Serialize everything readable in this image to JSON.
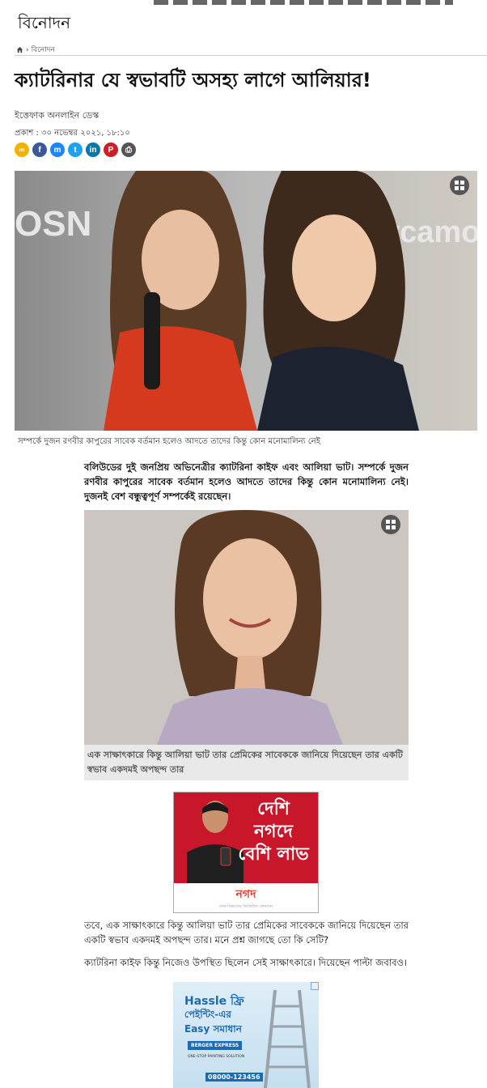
{
  "section": {
    "name": "বিনোদন"
  },
  "breadcrumb": {
    "current": "বিনোদন"
  },
  "article": {
    "headline": "ক্যাটরিনার যে স্বভাবটি অসহ্য লাগে আলিয়ার!",
    "author": "ইত্তেফাক অনলাইন ডেস্ক",
    "published": "প্রকাশ : ৩০ নভেম্বর ২০২১, ১৮:১০",
    "hero_caption": "সম্পর্কে দুজন রণবীর কাপুরের সাবেক বর্তমান হলেও আদতে তাদের কিন্তু কোন মনোমালিন্য নেই",
    "lead": "বলিউডের দুই জনপ্রিয় অভিনেত্রীর ক্যাটরিনা কাইফ এবং আলিয়া ভাট। সম্পর্কে দুজন রণবীর কাপুরের সাবেক বর্তমান হলেও আদতে তাদের কিন্তু কোন মনোমালিন্য নেই। দুজনই বেশ বন্ধুত্বপূর্ণ সম্পর্কেই রয়েছেন।",
    "photo2_caption": "এক সাক্ষাৎকারে কিন্তু আলিয়া ভাট তার প্রেমিকের সাবেককে জানিয়ে দিয়েছেন তার একটি স্বভাব একদমই অপছন্দ তার",
    "para2": "তবে, এক সাক্ষাৎকারে কিন্তু আলিয়া ভাট তার প্রেমিকের সাবেককে জানিয়ে দিয়েছেন তার একটি স্বভাব একদমই অপছন্দ তার। মনে প্রশ্ন জাগছে তো কি সেটি?",
    "para3": "ক্যাটরিনা কাইফ কিন্তু নিজেও উপস্থিত ছিলেন সেই সাক্ষাৎকারে। দিয়েছেন পাল্টা জবাবও।"
  },
  "hero_image": {
    "logo_left": "OSN",
    "logo_right": "ycamo"
  },
  "share_icons": [
    {
      "name": "link-share-icon",
      "glyph": "∞",
      "color": "#f0b400"
    },
    {
      "name": "facebook-share-icon",
      "glyph": "f",
      "color": "#3b5998"
    },
    {
      "name": "messenger-share-icon",
      "glyph": "m",
      "color": "#1b86f7"
    },
    {
      "name": "twitter-share-icon",
      "glyph": "t",
      "color": "#1da1f2"
    },
    {
      "name": "linkedin-share-icon",
      "glyph": "in",
      "color": "#0e76a8"
    },
    {
      "name": "pinterest-share-icon",
      "glyph": "P",
      "color": "#cb2027"
    },
    {
      "name": "print-icon",
      "glyph": "⎙",
      "color": "#555555"
    }
  ],
  "ad1": {
    "headline": "দেশি নগদে বেশি লাভ",
    "brand": "নগদ",
    "sub": "ডাক বিভাগের ডিজিটাল লেনদেন"
  },
  "ad2": {
    "line1": "Hassle ফ্রি",
    "line2": "পেইন্টিং-এর",
    "line3": "Easy সমাধান",
    "brand": "BERGER EXPRESS",
    "sub": "ONE-STOP PAINTING SOLUTION",
    "phone": "08000-123456"
  },
  "colors": {
    "accent": "#c8162a",
    "text": "#111111",
    "caption_bg": "#e9e9e9"
  }
}
